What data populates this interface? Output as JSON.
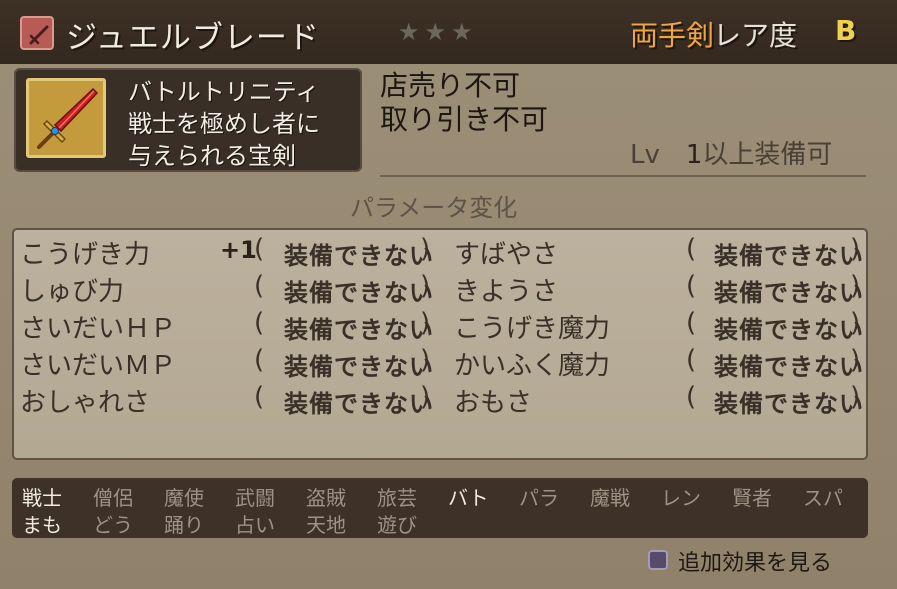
{
  "header": {
    "item_name": "ジュエルブレード",
    "stars": "★★★",
    "category": "両手剣",
    "rarity_label": "レア度",
    "rarity_grade": "B"
  },
  "description": {
    "lines": [
      "バトルトリニティ",
      "戦士を極めし者に",
      "与えられる宝剣"
    ]
  },
  "trade": {
    "sell": "店売り不可",
    "trade": "取り引き不可"
  },
  "equip_level": {
    "prefix": "Lv",
    "value": "1",
    "suffix": "以上装備可"
  },
  "params_title": "パラメータ変化",
  "params": {
    "left": [
      {
        "name": "こうげき力",
        "mod": "+1",
        "status": "装備できない"
      },
      {
        "name": "しゅび力",
        "mod": "",
        "status": "装備できない"
      },
      {
        "name": "さいだいＨＰ",
        "mod": "",
        "status": "装備できない"
      },
      {
        "name": "さいだいＭＰ",
        "mod": "",
        "status": "装備できない"
      },
      {
        "name": "おしゃれさ",
        "mod": "",
        "status": "装備できない"
      }
    ],
    "right": [
      {
        "name": "すばやさ",
        "status": "装備できない"
      },
      {
        "name": "きようさ",
        "status": "装備できない"
      },
      {
        "name": "こうげき魔力",
        "status": "装備できない"
      },
      {
        "name": "かいふく魔力",
        "status": "装備できない"
      },
      {
        "name": "おもさ",
        "status": "装備できない"
      }
    ]
  },
  "jobs": {
    "row1": [
      {
        "label": "戦士",
        "enabled": true
      },
      {
        "label": "僧侶",
        "enabled": false
      },
      {
        "label": "魔使",
        "enabled": false
      },
      {
        "label": "武闘",
        "enabled": false
      },
      {
        "label": "盗賊",
        "enabled": false
      },
      {
        "label": "旅芸",
        "enabled": false
      },
      {
        "label": "バト",
        "enabled": true
      },
      {
        "label": "パラ",
        "enabled": false
      },
      {
        "label": "魔戦",
        "enabled": false
      },
      {
        "label": "レン",
        "enabled": false
      },
      {
        "label": "賢者",
        "enabled": false
      },
      {
        "label": "スパ",
        "enabled": false
      }
    ],
    "row2": [
      {
        "label": "まも",
        "enabled": true
      },
      {
        "label": "どう",
        "enabled": false
      },
      {
        "label": "踊り",
        "enabled": false
      },
      {
        "label": "占い",
        "enabled": false
      },
      {
        "label": "天地",
        "enabled": false
      },
      {
        "label": "遊び",
        "enabled": false
      }
    ]
  },
  "footer": {
    "view_effects": "追加効果を見る"
  },
  "icons": {
    "item_type": "sword-icon",
    "item_image": "jewel-blade-sword",
    "button": "square-button-icon"
  },
  "colors": {
    "category": "#f0a640",
    "rarity_grade": "#f0d050",
    "job_enabled": "#f1ebdf",
    "job_disabled": "#9d9284"
  }
}
